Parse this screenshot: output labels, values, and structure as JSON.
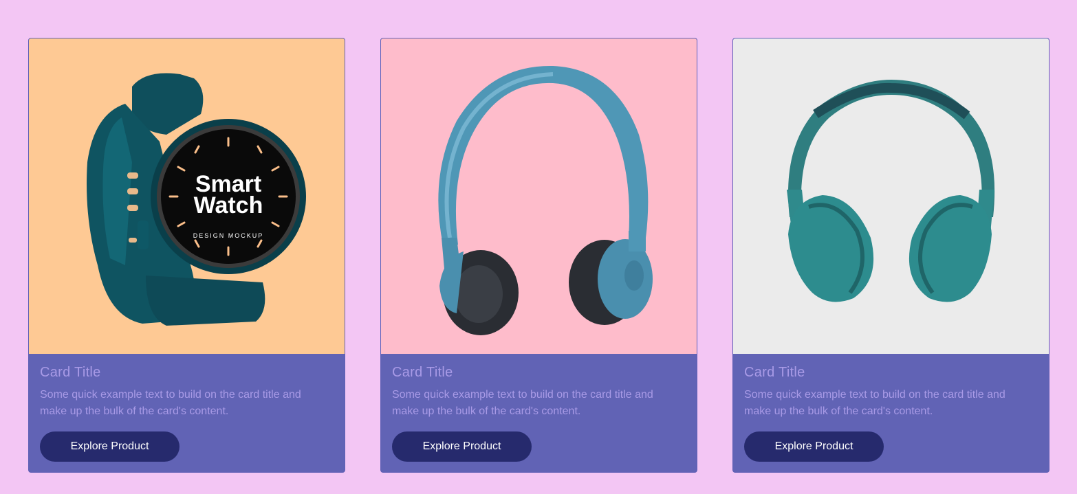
{
  "cards": [
    {
      "image_name": "smartwatch-image",
      "image_bg": "#fec994",
      "image_text_line1": "Smart",
      "image_text_line2": "Watch",
      "image_text_sub": "DESIGN MOCKUP",
      "title": "Card Title",
      "text": "Some quick example text to build on the card title and make up the bulk of the card's content.",
      "button_label": "Explore Product"
    },
    {
      "image_name": "blue-headphones-image",
      "image_bg": "#febccb",
      "title": "Card Title",
      "text": "Some quick example text to build on the card title and make up the bulk of the card's content.",
      "button_label": "Explore Product"
    },
    {
      "image_name": "teal-headphones-image",
      "image_bg": "#ebebeb",
      "title": "Card Title",
      "text": "Some quick example text to build on the card title and make up the bulk of the card's content.",
      "button_label": "Explore Product"
    }
  ],
  "colors": {
    "page_bg": "#f3c6f4",
    "card_body_bg": "#6163b5",
    "card_text": "#a89ae6",
    "button_bg": "#262a6d",
    "button_text": "#ffffff"
  }
}
